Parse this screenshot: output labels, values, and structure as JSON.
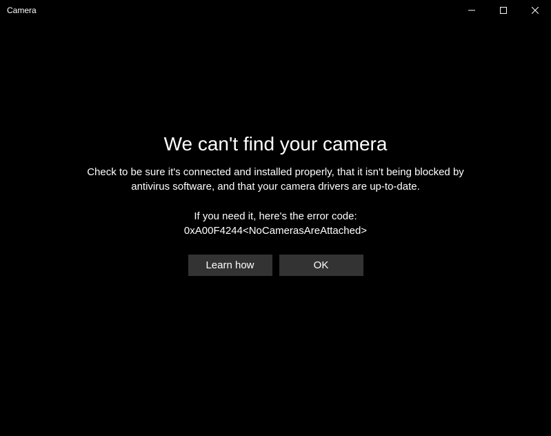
{
  "titlebar": {
    "title": "Camera"
  },
  "error": {
    "heading": "We can't find your camera",
    "description": "Check to be sure it's connected and installed properly, that it isn't being blocked by antivirus software, and that your camera drivers are up-to-date.",
    "code_label": "If you need it, here's the error code:",
    "code_value": "0xA00F4244<NoCamerasAreAttached>"
  },
  "buttons": {
    "learn_how": "Learn how",
    "ok": "OK"
  }
}
